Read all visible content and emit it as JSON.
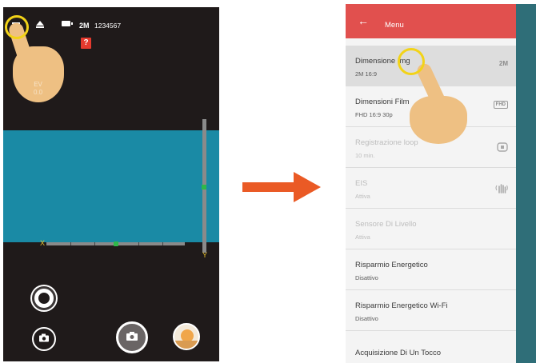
{
  "camera_view": {
    "status": {
      "resolution_badge": "2M",
      "counter": "1234567"
    },
    "sd_warning": "?",
    "ev_label": "EV\n0.0",
    "level": {
      "x_label": "X",
      "y_label": "Y"
    },
    "icons": {
      "menu": "menu-icon",
      "eject": "eject-icon",
      "battery": "battery-icon",
      "mode": "mode-icon",
      "camera": "camera-icon",
      "shutter": "shutter-icon",
      "gallery": "gallery-thumbnail"
    }
  },
  "arrow": {
    "color": "#ea5a25"
  },
  "settings_menu": {
    "header": {
      "back": "←",
      "title": "Menu",
      "color": "#e1504e"
    },
    "items": [
      {
        "title": "Dimensione Img",
        "subtitle": "2M 16:9",
        "icon": "2M",
        "state": "selected"
      },
      {
        "title": "Dimensioni Film",
        "subtitle": "FHD 16:9 30p",
        "icon": "FHD",
        "state": "enabled"
      },
      {
        "title": "Registrazione loop",
        "subtitle": "10 min.",
        "icon": "loop-icon",
        "state": "disabled"
      },
      {
        "title": "EIS",
        "subtitle": "Attiva",
        "icon": "eis-icon",
        "state": "disabled"
      },
      {
        "title": "Sensore Di Livello",
        "subtitle": "Attiva",
        "icon": "",
        "state": "disabled"
      },
      {
        "title": "Risparmio Energetico",
        "subtitle": "Disattivo",
        "icon": "",
        "state": "enabled"
      },
      {
        "title": "Risparmio Energetico Wi-Fi",
        "subtitle": "Disattivo",
        "icon": "",
        "state": "enabled"
      },
      {
        "title": "Acquisizione Di Un Tocco",
        "subtitle": "",
        "icon": "",
        "state": "enabled"
      }
    ]
  }
}
